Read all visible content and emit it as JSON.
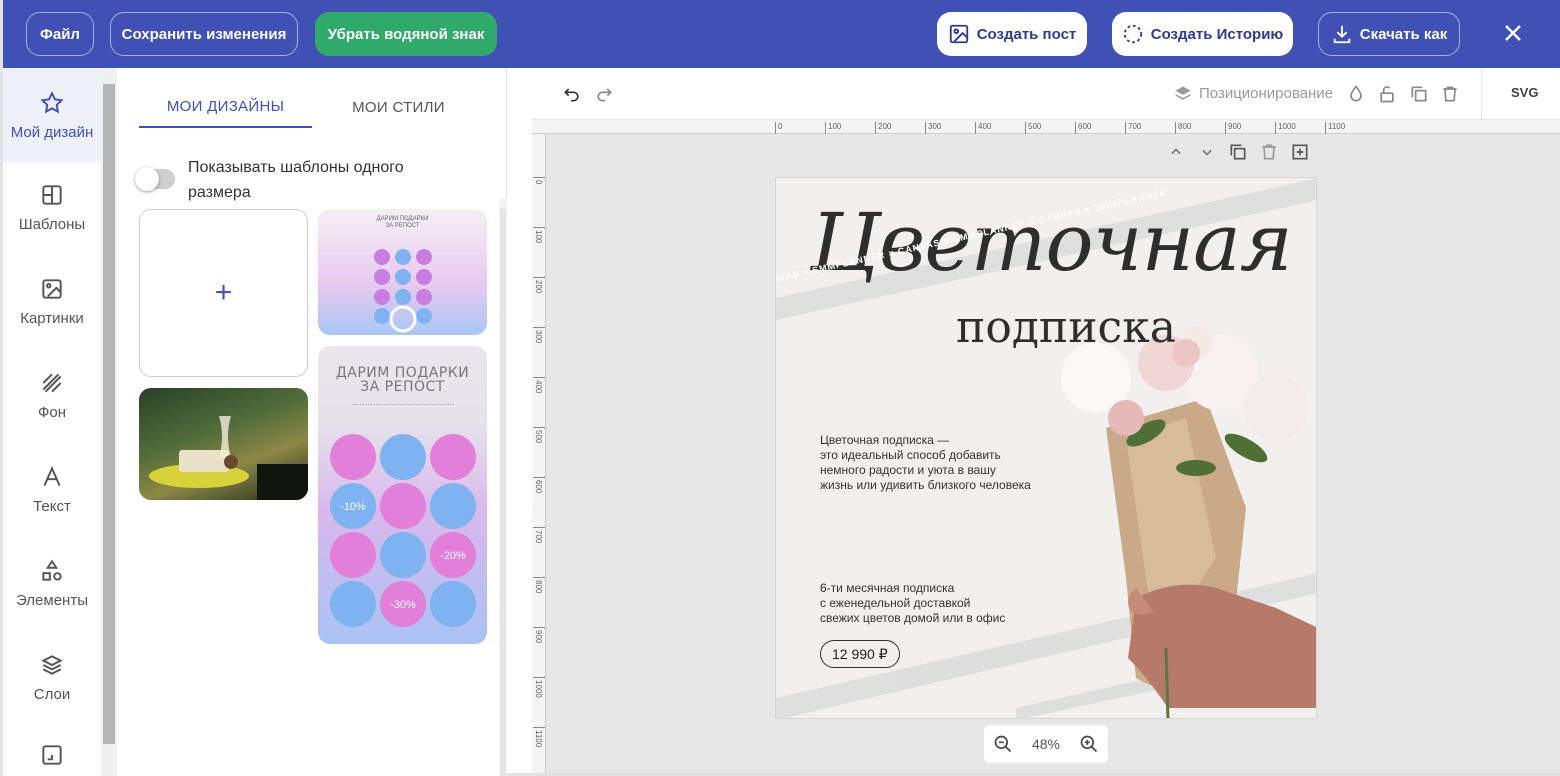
{
  "topbar": {
    "file": "Файл",
    "save": "Сохранить изменения",
    "remove_watermark": "Убрать водяной знак",
    "create_post": "Создать пост",
    "create_story": "Создать Историю",
    "download": "Скачать как"
  },
  "nav": {
    "my_design": "Мой дизайн",
    "templates": "Шаблоны",
    "images": "Картинки",
    "background": "Фон",
    "text": "Текст",
    "elements": "Элементы",
    "layers": "Слои"
  },
  "panel": {
    "tab_designs": "МОИ ДИЗАЙНЫ",
    "tab_styles": "МОИ СТИЛИ",
    "toggle_label": "Показывать шаблоны одного размера",
    "add_symbol": "+",
    "tpl2_small_title": "ДАРИМ ПОДАРКИ\nЗА РЕПОСТ",
    "tpl3_title_line1": "ДАРИМ ПОДАРКИ",
    "tpl3_title_line2": "ЗА РЕПОСТ",
    "tpl3_circles": [
      "",
      "",
      "",
      "-10%",
      "",
      "",
      "",
      "",
      "-20%",
      "",
      "-30%",
      ""
    ]
  },
  "toolbar": {
    "positioning": "Позиционирование",
    "svg": "SVG"
  },
  "ruler": {
    "h": [
      "0",
      "100",
      "200",
      "300",
      "400",
      "500",
      "600",
      "700",
      "800",
      "900",
      "1000",
      "1100"
    ],
    "v": [
      "0",
      "100",
      "200",
      "300",
      "400",
      "500",
      "600",
      "700",
      "800",
      "900",
      "1000",
      "1100"
    ]
  },
  "design": {
    "script_title": "Цветочная",
    "subtitle": "подписка",
    "paragraph1": [
      "Цветочная подписка —",
      "это идеальный способ добавить",
      "немного радости и уюта в вашу",
      "жизнь или удивить близкого человека"
    ],
    "paragraph2": [
      "6-ти месячная подписка",
      "с еженедельной доставкой",
      "свежих цветов домой или в офис"
    ],
    "price": "12 990 ₽",
    "watermark": "CANVAS × SMMPLANNER × CANVAS × SMMPLANNER × CANVAS × SMMPLANNER"
  },
  "zoom": {
    "value": "48%"
  }
}
